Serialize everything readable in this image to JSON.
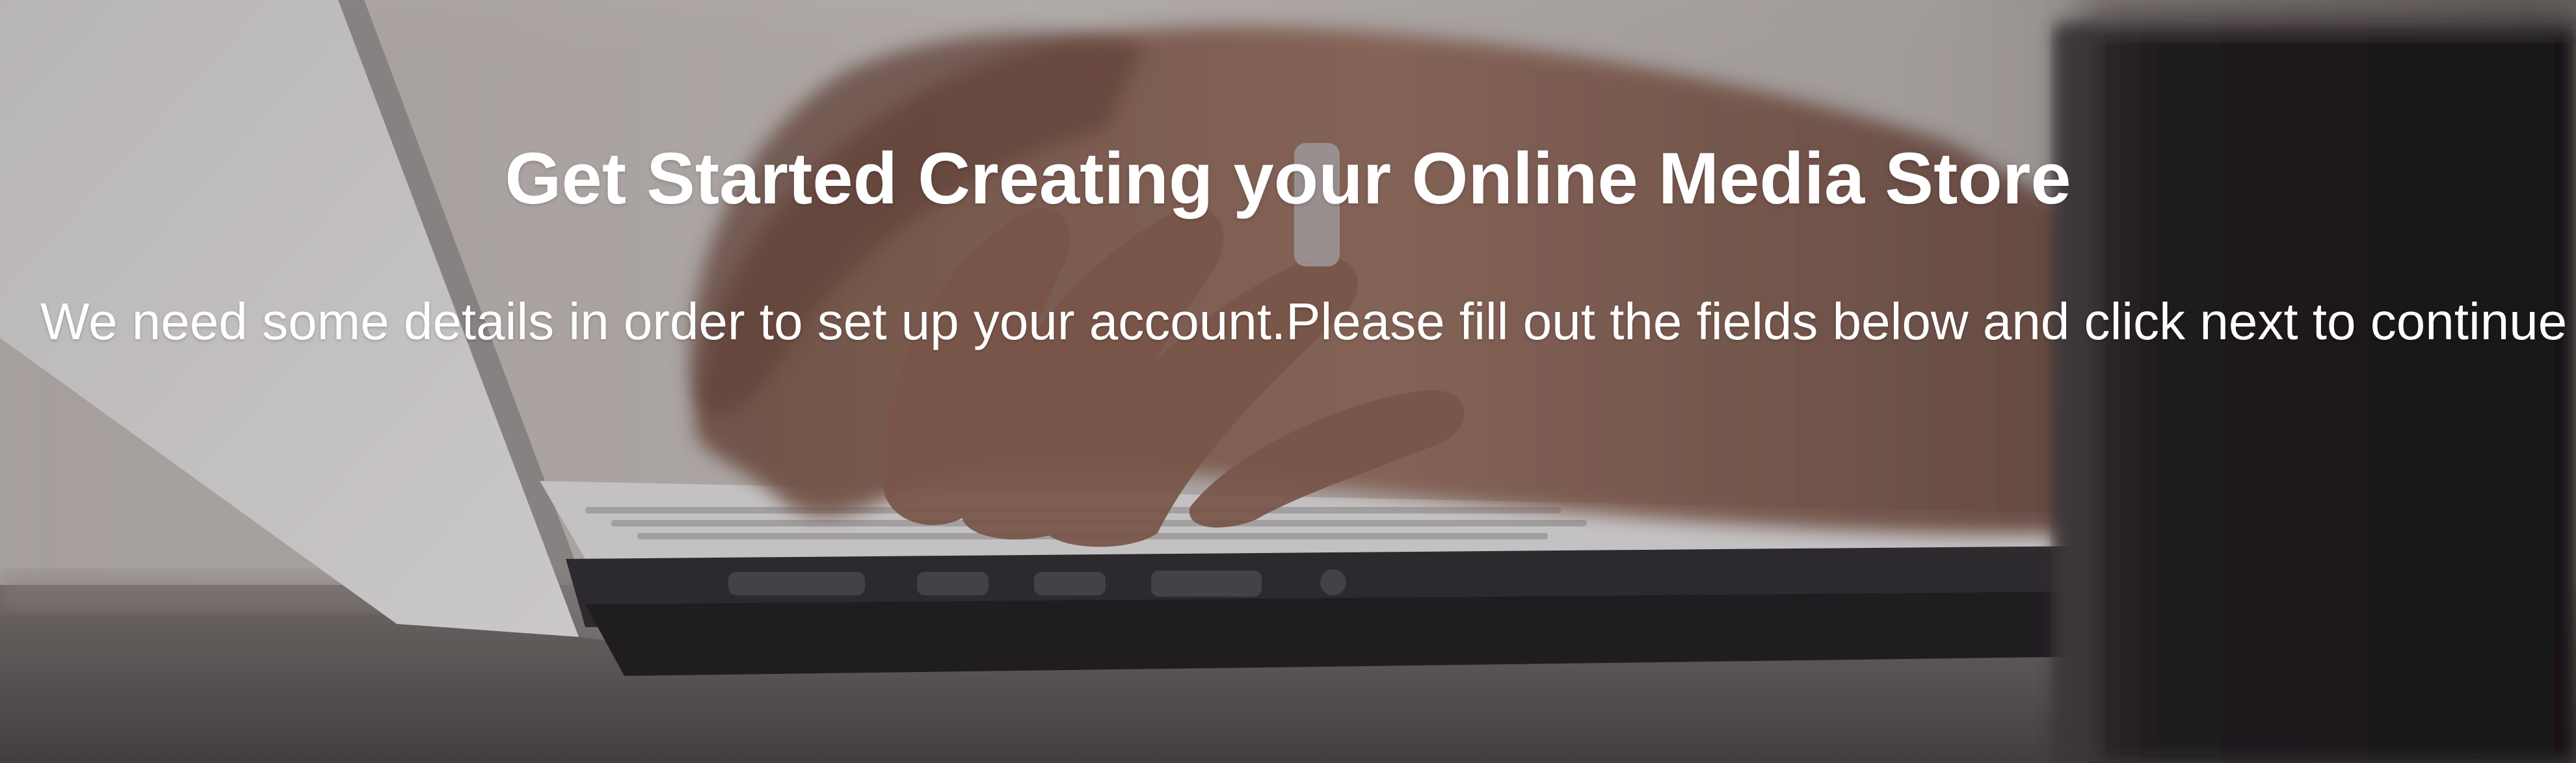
{
  "hero": {
    "title": "Get Started Creating your Online Media Store",
    "subtitle": "We need some details in order to set up your account.Please fill out the fields below and click next to continue"
  },
  "background": {
    "description_icon": "laptop-typing-photo",
    "colors": {
      "wall": "#c9c2bf",
      "laptop_body": "#e4e2e3",
      "laptop_base": "#2e2c31",
      "skin": "#8a6454",
      "desk": "#5d5756",
      "mug": "#221e20"
    }
  }
}
